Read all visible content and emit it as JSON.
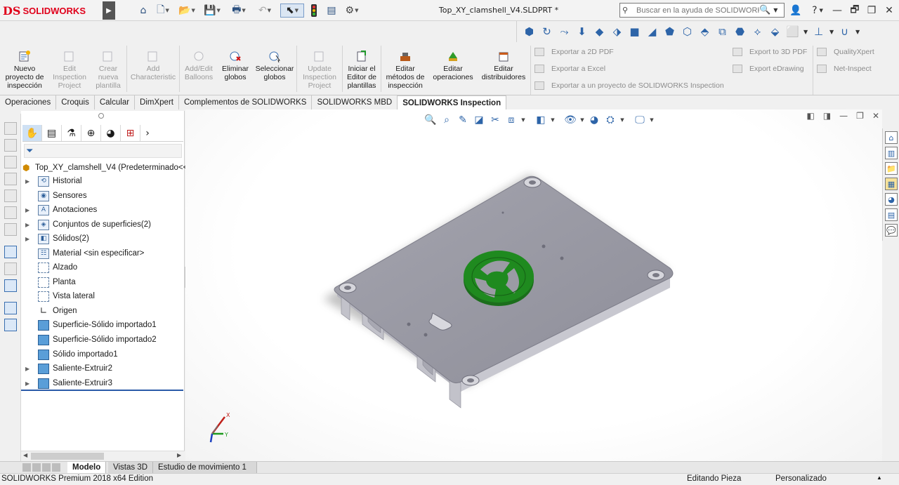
{
  "app": {
    "logo_text": "SOLIDWORKS",
    "document_title": "Top_XY_clamshell_V4.SLDPRT *",
    "search_placeholder": "Buscar en la ayuda de SOLIDWORKS",
    "colors": {
      "brand": "#e0001b",
      "accent": "#2d64a8",
      "part_body": "#9b9ba5",
      "part_feature": "#1f7a1f"
    }
  },
  "quick_access": {
    "icons": [
      "home-icon",
      "new-document-icon",
      "open-icon",
      "save-icon",
      "print-icon",
      "undo-icon",
      "select-icon",
      "rebuild-icon",
      "file-properties-icon",
      "options-icon"
    ]
  },
  "command_manager": {
    "buttons": [
      {
        "label": "Nuevo\nproyecto de\ninspección",
        "enabled": true,
        "icon": "new-inspection-project-icon"
      },
      {
        "label": "Edit\nInspection\nProject",
        "enabled": false,
        "icon": "edit-inspection-project-icon"
      },
      {
        "label": "Crear\nnueva\nplantilla",
        "enabled": false,
        "icon": "create-template-icon"
      },
      {
        "label": "Add\nCharacteristic",
        "enabled": false,
        "icon": "add-characteristic-icon"
      },
      {
        "label": "Add/Edit\nBalloons",
        "enabled": false,
        "icon": "add-balloons-icon"
      },
      {
        "label": "Eliminar\nglobos",
        "enabled": true,
        "icon": "delete-balloons-icon"
      },
      {
        "label": "Seleccionar\nglobos",
        "enabled": true,
        "icon": "select-balloons-icon"
      },
      {
        "label": "Update\nInspection\nProject",
        "enabled": false,
        "icon": "update-inspection-project-icon"
      },
      {
        "label": "Iniciar el\nEditor de\nplantillas",
        "enabled": true,
        "icon": "template-editor-icon"
      },
      {
        "label": "Editar\nmétodos de\ninspección",
        "enabled": true,
        "icon": "edit-inspection-methods-icon"
      },
      {
        "label": "Editar\noperaciones",
        "enabled": true,
        "icon": "edit-operations-icon"
      },
      {
        "label": "Editar\ndistribuidores",
        "enabled": true,
        "icon": "edit-vendors-icon"
      }
    ],
    "export_left": [
      "Exportar a 2D PDF",
      "Exportar a Excel",
      "Exportar a un proyecto de SOLIDWORKS Inspection"
    ],
    "export_right": [
      "Export to 3D PDF",
      "Export eDrawing"
    ],
    "extra": [
      "QualityXpert",
      "Net-Inspect"
    ]
  },
  "tabs": [
    {
      "label": "Operaciones",
      "active": false
    },
    {
      "label": "Croquis",
      "active": false
    },
    {
      "label": "Calcular",
      "active": false
    },
    {
      "label": "DimXpert",
      "active": false
    },
    {
      "label": "Complementos de SOLIDWORKS",
      "active": false
    },
    {
      "label": "SOLIDWORKS MBD",
      "active": false
    },
    {
      "label": "SOLIDWORKS Inspection",
      "active": true
    }
  ],
  "feature_tree": {
    "root": "Top_XY_clamshell_V4  (Predeterminado<<",
    "items": [
      {
        "label": "Historial",
        "expandable": true,
        "icon": "history-icon"
      },
      {
        "label": "Sensores",
        "expandable": false,
        "icon": "sensors-icon"
      },
      {
        "label": "Anotaciones",
        "expandable": true,
        "icon": "annotations-icon"
      },
      {
        "label": "Conjuntos de superficies(2)",
        "expandable": true,
        "icon": "surface-bodies-icon"
      },
      {
        "label": "Sólidos(2)",
        "expandable": true,
        "icon": "solid-bodies-icon"
      },
      {
        "label": "Material <sin especificar>",
        "expandable": false,
        "icon": "material-icon"
      },
      {
        "label": "Alzado",
        "expandable": false,
        "icon": "plane-icon"
      },
      {
        "label": "Planta",
        "expandable": false,
        "icon": "plane-icon"
      },
      {
        "label": "Vista lateral",
        "expandable": false,
        "icon": "plane-icon"
      },
      {
        "label": "Origen",
        "expandable": false,
        "icon": "origin-icon"
      },
      {
        "label": "Superficie-Sólido importado1",
        "expandable": false,
        "icon": "imported-surface-icon"
      },
      {
        "label": "Superficie-Sólido importado2",
        "expandable": false,
        "icon": "imported-surface-icon"
      },
      {
        "label": "Sólido importado1",
        "expandable": false,
        "icon": "imported-solid-icon"
      },
      {
        "label": "Saliente-Extruir2",
        "expandable": true,
        "icon": "boss-extrude-icon"
      },
      {
        "label": "Saliente-Extruir3",
        "expandable": true,
        "icon": "boss-extrude-icon"
      }
    ]
  },
  "triad": {
    "x": "X",
    "y": "Y"
  },
  "bottom_tabs": [
    {
      "label": "Modelo",
      "active": true
    },
    {
      "label": "Vistas 3D",
      "active": false
    },
    {
      "label": "Estudio de movimiento 1",
      "active": false
    }
  ],
  "status": {
    "edition": "SOLIDWORKS Premium 2018 x64 Edition",
    "mode": "Editando Pieza",
    "units": "Personalizado"
  }
}
